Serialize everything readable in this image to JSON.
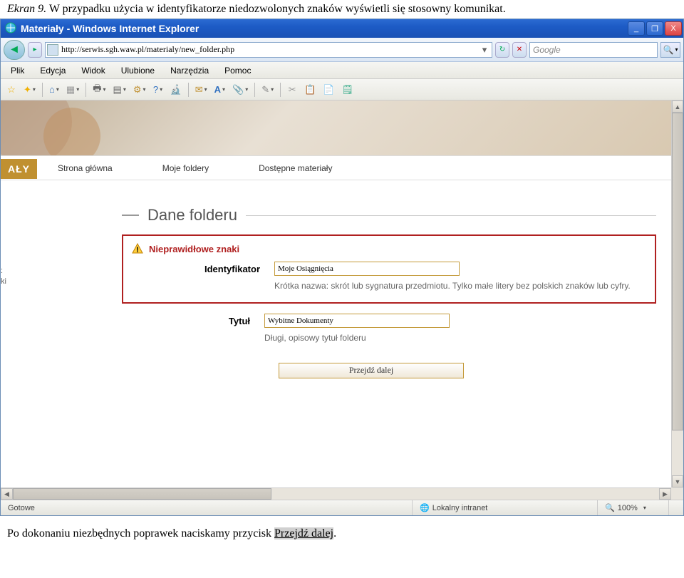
{
  "caption_top": {
    "label": "Ekran 9.",
    "text": " W przypadku użycia w identyfikatorze niedozwolonych znaków wyświetli się stosowny komunikat."
  },
  "window": {
    "title": "Materiały - Windows Internet Explorer",
    "min_label": "_",
    "max_label": "❐",
    "close_label": "X"
  },
  "nav": {
    "back": "◄",
    "fwd": "▸",
    "url": "http://serwis.sgh.waw.pl/materialy/new_folder.php",
    "drop": "▾",
    "refresh": "↻",
    "stop": "✕",
    "search_placeholder": "Google",
    "search_icon": "🔍"
  },
  "menu": [
    "Plik",
    "Edycja",
    "Widok",
    "Ulubione",
    "Narzędzia",
    "Pomoc"
  ],
  "toolbar_icons": {
    "fav_add": "☆",
    "fav_star": "✦",
    "home": "⌂",
    "rss": "▦",
    "print": "🖶",
    "page": "▤",
    "tools": "⚙",
    "help": "?",
    "research": "🔬",
    "msg": "✉",
    "font": "A",
    "links": "📎",
    "edit": "✎",
    "cut": "✂",
    "copy": "📋",
    "paste": "📄",
    "note": "🗒"
  },
  "page": {
    "aly": "AŁY",
    "sitenav": [
      "Strona główna",
      "Moje foldery",
      "Dostępne materiały"
    ],
    "side_marks": ":\nki",
    "fieldset_title": "Dane folderu",
    "error_title": "Nieprawidłowe znaki",
    "id_label": "Identyfikator",
    "id_value": "Moje Osiągnięcia",
    "id_help": "Krótka nazwa: skrót lub sygnatura przedmiotu. Tylko małe litery bez polskich znaków lub cyfry.",
    "title_label": "Tytuł",
    "title_value": "Wybitne Dokumenty",
    "title_help": "Długi, opisowy tytuł folderu",
    "submit": "Przejdź dalej"
  },
  "status": {
    "ready": "Gotowe",
    "zone_icon": "🌐",
    "zone": "Lokalny intranet",
    "zoom_icon": "🔍",
    "zoom": "100%"
  },
  "caption_bottom": {
    "text": "Po dokonaniu niezbędnych poprawek naciskamy przycisk ",
    "link": "Przejdź dalej",
    "tail": "."
  }
}
